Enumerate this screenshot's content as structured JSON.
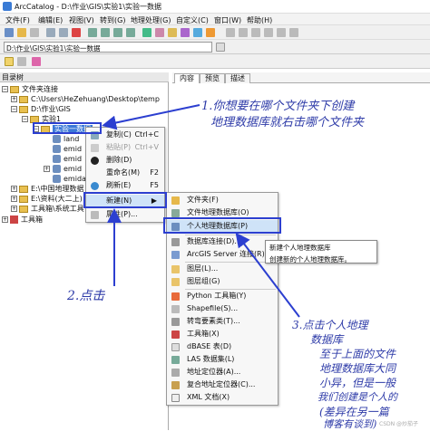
{
  "window": {
    "title": "ArcCatalog - D:\\作业\\GIS\\实验1\\实验一数据"
  },
  "menubar": [
    "文件(F)",
    "编辑(E)",
    "视图(V)",
    "转到(G)",
    "地理处理(G)",
    "自定义(C)",
    "窗口(W)",
    "帮助(H)"
  ],
  "location": {
    "value": "D:\\作业\\GIS\\实验1\\实验一数据"
  },
  "tree": {
    "header": "目录树",
    "items": [
      "文件夹连接",
      "C:\\Users\\HeZehuang\\Desktop\\temp",
      "D:\\作业\\GIS",
      "实验1",
      "实验一数据",
      "land",
      "emid",
      "emid",
      "emid",
      "emidast",
      "E:\\中国地理数据",
      "E:\\资料(大二上)",
      "工具箱\\系统工具",
      "工具箱"
    ]
  },
  "tabs": [
    "内容",
    "预览",
    "描述"
  ],
  "context_menu": {
    "items": [
      {
        "label": "复制(C)",
        "shortcut": "Ctrl+C"
      },
      {
        "label": "粘贴(P)",
        "shortcut": "Ctrl+V"
      },
      {
        "label": "删除(D)",
        "shortcut": ""
      },
      {
        "label": "重命名(M)",
        "shortcut": "F2"
      },
      {
        "label": "刷新(E)",
        "shortcut": "F5"
      },
      {
        "label": "新建(N)",
        "shortcut": ""
      },
      {
        "label": "属性(P)...",
        "shortcut": ""
      }
    ]
  },
  "submenu": {
    "items": [
      "文件夹(F)",
      "文件地理数据库(O)",
      "个人地理数据库(P)",
      "数据库连接(D)...",
      "ArcGIS Server 连接(R)...",
      "图层(L)...",
      "图层组(G)",
      "Python 工具箱(Y)",
      "Shapefile(S)...",
      "转弯要素类(T)...",
      "工具箱(X)",
      "dBASE 表(D)",
      "LAS 数据集(L)",
      "地址定位器(A)...",
      "复合地址定位器(C)...",
      "XML 文档(X)"
    ]
  },
  "tooltip": {
    "title": "新建个人地理数据库",
    "desc": "创建新的个人地理数据库。"
  },
  "annotations": {
    "a1_line1": "1.你想要在哪个文件夹下创建",
    "a1_line2": "地理数据库就右击哪个文件夹",
    "a2": "2.点击",
    "a3_line1": "3.点击个人地理",
    "a3_line2": "数据库",
    "a3_line3": "至于上面的文件",
    "a3_line4": "地理数据库大同",
    "a3_line5": "小异，但是一般",
    "a3_line6": "我们创建是个人的",
    "a3_line7": "(差异在另一篇",
    "a3_line8": "博客有谈到)"
  },
  "watermark": "CSDN @炒茄子",
  "colors": {
    "accent": "#2c3fd0",
    "selection": "#3b78d8",
    "annotation": "#2e3ba8"
  }
}
